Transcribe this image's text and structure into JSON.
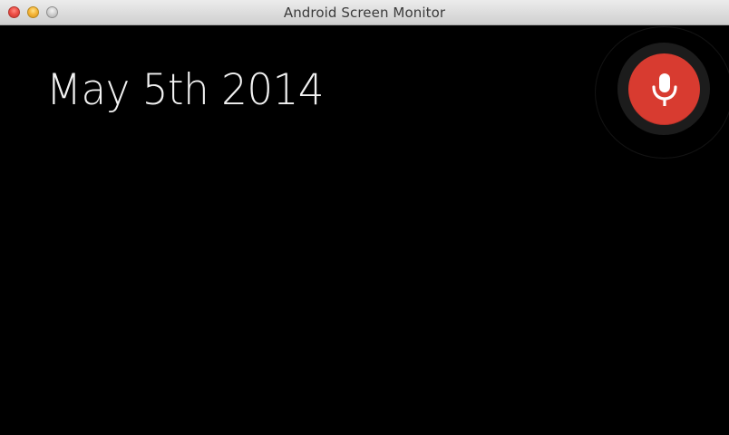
{
  "window": {
    "title": "Android Screen Monitor"
  },
  "screen": {
    "date": "May 5th 2014"
  },
  "voice_button": {
    "icon": "microphone-icon",
    "accent_color": "#d83b30"
  },
  "colors": {
    "background": "#000000",
    "date_text": "#f2f2f2",
    "close": "#ee5048",
    "minimize": "#f6b73b",
    "zoom": "#cfcfcf"
  }
}
